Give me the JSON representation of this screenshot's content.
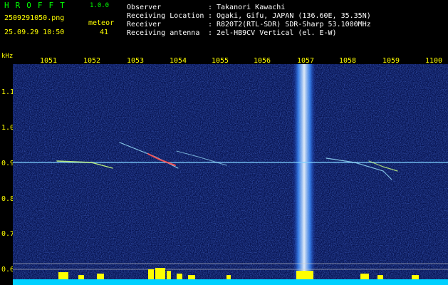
{
  "app": {
    "title": "HROFFT",
    "version": "1.0.0"
  },
  "file": {
    "name": "2509291050.png",
    "timestamp": "25.09.29 10:50"
  },
  "meteor": {
    "label": "meteor",
    "count": "41"
  },
  "info": [
    {
      "label": "Observer",
      "value": "Takanori Kawachi"
    },
    {
      "label": "Receiving Location",
      "value": "Ogaki, Gifu, JAPAN (136.60E, 35.35N)"
    },
    {
      "label": "Receiver",
      "value": "R820T2(RTL-SDR) SDR-Sharp 53.1000MHz"
    },
    {
      "label": "Receiving antenna",
      "value": "2el-HB9CV Vertical (el. E-W)"
    }
  ],
  "axis": {
    "unit": "kHz",
    "freq_labels": [
      "1051",
      "1052",
      "1053",
      "1054",
      "1055",
      "1056",
      "1057",
      "1058",
      "1059",
      "1100"
    ],
    "y_labels": [
      "1.1",
      "1.0",
      "0.9",
      "0.8",
      "0.7",
      "0.6"
    ]
  },
  "colors": {
    "text_yellow": "#ffff00",
    "text_white": "#ffffff",
    "background": "#000000",
    "noise": "#0a1a8c",
    "signal": "#ffffff",
    "activity_bar": "#ffff00",
    "baseline": "#00d0ff"
  }
}
